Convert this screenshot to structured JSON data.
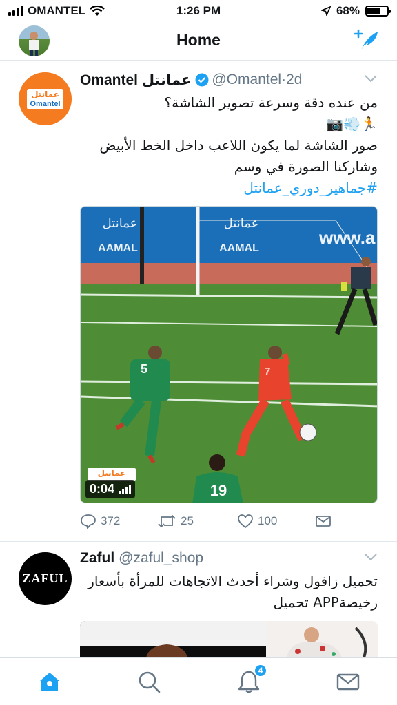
{
  "status_bar": {
    "carrier": "OMANTEL",
    "time": "1:26 PM",
    "battery": "68%",
    "battery_level": 0.68
  },
  "nav": {
    "title": "Home"
  },
  "tweets": [
    {
      "name": "Omantel عمانتل",
      "handle": "@Omantel",
      "time": "2d",
      "verified": true,
      "avatar_text": {
        "arabic": "عمانتل",
        "latin": "Omantel"
      },
      "lines": [
        "من عنده دقة وسرعة تصوير الشاشة؟",
        "🏃💨📷",
        "صور الشاشة لما يكون اللاعب داخل الخط الأبيض",
        "وشاركنا الصورة في وسم"
      ],
      "hashtag": "#جماهير_دوري_عمانتل",
      "video": {
        "duration": "0:04",
        "ads": [
          "عمانتل",
          "AAMAL",
          "www.a"
        ],
        "jerseys": [
          "5",
          "7",
          "19"
        ],
        "overlay_logo": "عمانتل"
      },
      "counts": {
        "replies": "372",
        "retweets": "25",
        "likes": "100"
      }
    },
    {
      "name": "Zaful",
      "handle": "@zaful_shop",
      "avatar_text": "ZAFUL",
      "lines": [
        "تحميل زافول وشراء أحدث الاتجاهات للمرأة بأسعار",
        "رخيصةAPP تحميل"
      ]
    }
  ],
  "tabbar": {
    "notifications_badge": "4"
  },
  "colors": {
    "accent": "#1da1f2",
    "text": "#14171a",
    "muted": "#657786",
    "omantel_orange": "#f47b20"
  },
  "icons": [
    "wifi-icon",
    "location-arrow-icon",
    "compose-tweet-icon",
    "verified-badge-icon",
    "chevron-down-icon",
    "reply-icon",
    "retweet-icon",
    "like-icon",
    "direct-message-icon",
    "home-icon",
    "search-icon",
    "notifications-icon",
    "messages-icon"
  ]
}
